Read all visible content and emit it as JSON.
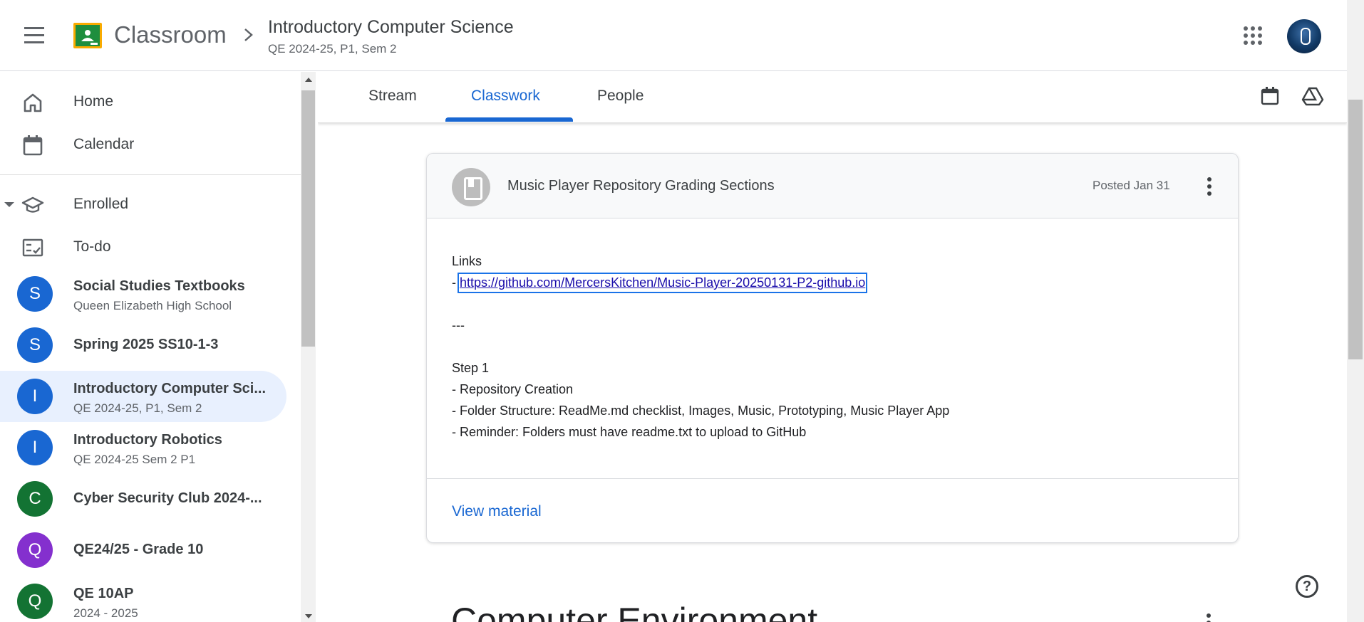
{
  "header": {
    "brand": "Classroom",
    "course_title": "Introductory Computer Science",
    "course_sub": "QE 2024-25, P1, Sem 2",
    "icons": [
      "menu-icon",
      "classroom-logo",
      "chevron-right-icon",
      "apps-grid-icon",
      "account-avatar"
    ]
  },
  "sidebar": {
    "nav": [
      {
        "label": "Home",
        "icon": "home-icon"
      },
      {
        "label": "Calendar",
        "icon": "calendar-icon"
      },
      {
        "label": "Enrolled",
        "icon": "graduation-cap-icon"
      },
      {
        "label": "To-do",
        "icon": "checklist-icon"
      }
    ],
    "classes": [
      {
        "initial": "S",
        "name": "Social Studies Textbooks",
        "sub": "Queen Elizabeth High School",
        "color": "#1967d2"
      },
      {
        "initial": "S",
        "name": "Spring 2025 SS10-1-3",
        "sub": "",
        "color": "#1967d2"
      },
      {
        "initial": "I",
        "name": "Introductory Computer Sci...",
        "sub": "QE 2024-25, P1, Sem 2",
        "color": "#1967d2"
      },
      {
        "initial": "I",
        "name": "Introductory Robotics",
        "sub": "QE 2024-25 Sem 2 P1",
        "color": "#1967d2"
      },
      {
        "initial": "C",
        "name": "Cyber Security Club 2024-...",
        "sub": "",
        "color": "#137333"
      },
      {
        "initial": "Q",
        "name": "QE24/25 - Grade 10",
        "sub": "",
        "color": "#8430ce"
      },
      {
        "initial": "Q",
        "name": "QE 10AP",
        "sub": "2024 - 2025",
        "color": "#137333"
      }
    ]
  },
  "tabs": [
    {
      "label": "Stream"
    },
    {
      "label": "Classwork",
      "active": true
    },
    {
      "label": "People"
    }
  ],
  "material": {
    "title": "Music Player Repository Grading Sections",
    "posted": "Posted Jan 31",
    "body": {
      "links_heading": "Links",
      "dash": "-",
      "link": "https://github.com/MercersKitchen/Music-Player-20250131-P2-github.io",
      "separator": "---",
      "step_heading": "Step 1",
      "step_items": [
        "- Repository Creation",
        "- Folder Structure: ReadMe.md checklist, Images, Music, Prototyping, Music Player App",
        "- Reminder: Folders must have readme.txt to upload to GitHub"
      ]
    },
    "view_label": "View material"
  },
  "next_section_title": "Computer Environment",
  "help_label": "?",
  "colors": {
    "accent": "#1967d2",
    "active_bg": "#e8f0fe",
    "link_focus": "#1a73e8"
  }
}
